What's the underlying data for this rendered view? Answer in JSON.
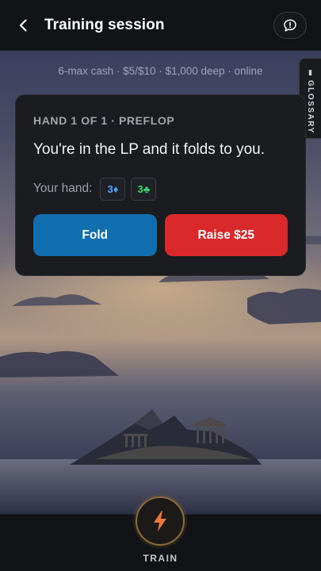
{
  "header": {
    "title": "Training session",
    "back_icon": "chevron-left-icon",
    "feedback_icon": "speech-bubble-alert-icon"
  },
  "game_info": "6-max cash · $5/$10 · $1,000 deep · online",
  "glossary": {
    "label": "GLOSSARY",
    "icon": "book-icon"
  },
  "hand_card": {
    "heading": "HAND 1 OF 1 · PREFLOP",
    "prompt": "You're in the LP and it folds to you.",
    "hand_label": "Your hand:",
    "cards": [
      {
        "text": "3♦",
        "suit": "diamond",
        "color": "#4aa2ff"
      },
      {
        "text": "3♣",
        "suit": "club",
        "color": "#3ed46e"
      }
    ],
    "actions": {
      "fold_label": "Fold",
      "raise_label": "Raise $25"
    }
  },
  "bottom_nav": {
    "train_label": "TRAIN",
    "train_icon": "lightning-bolt-icon"
  },
  "colors": {
    "fold": "#116fb0",
    "raise": "#d9292a",
    "train_accent": "#e8793a"
  }
}
